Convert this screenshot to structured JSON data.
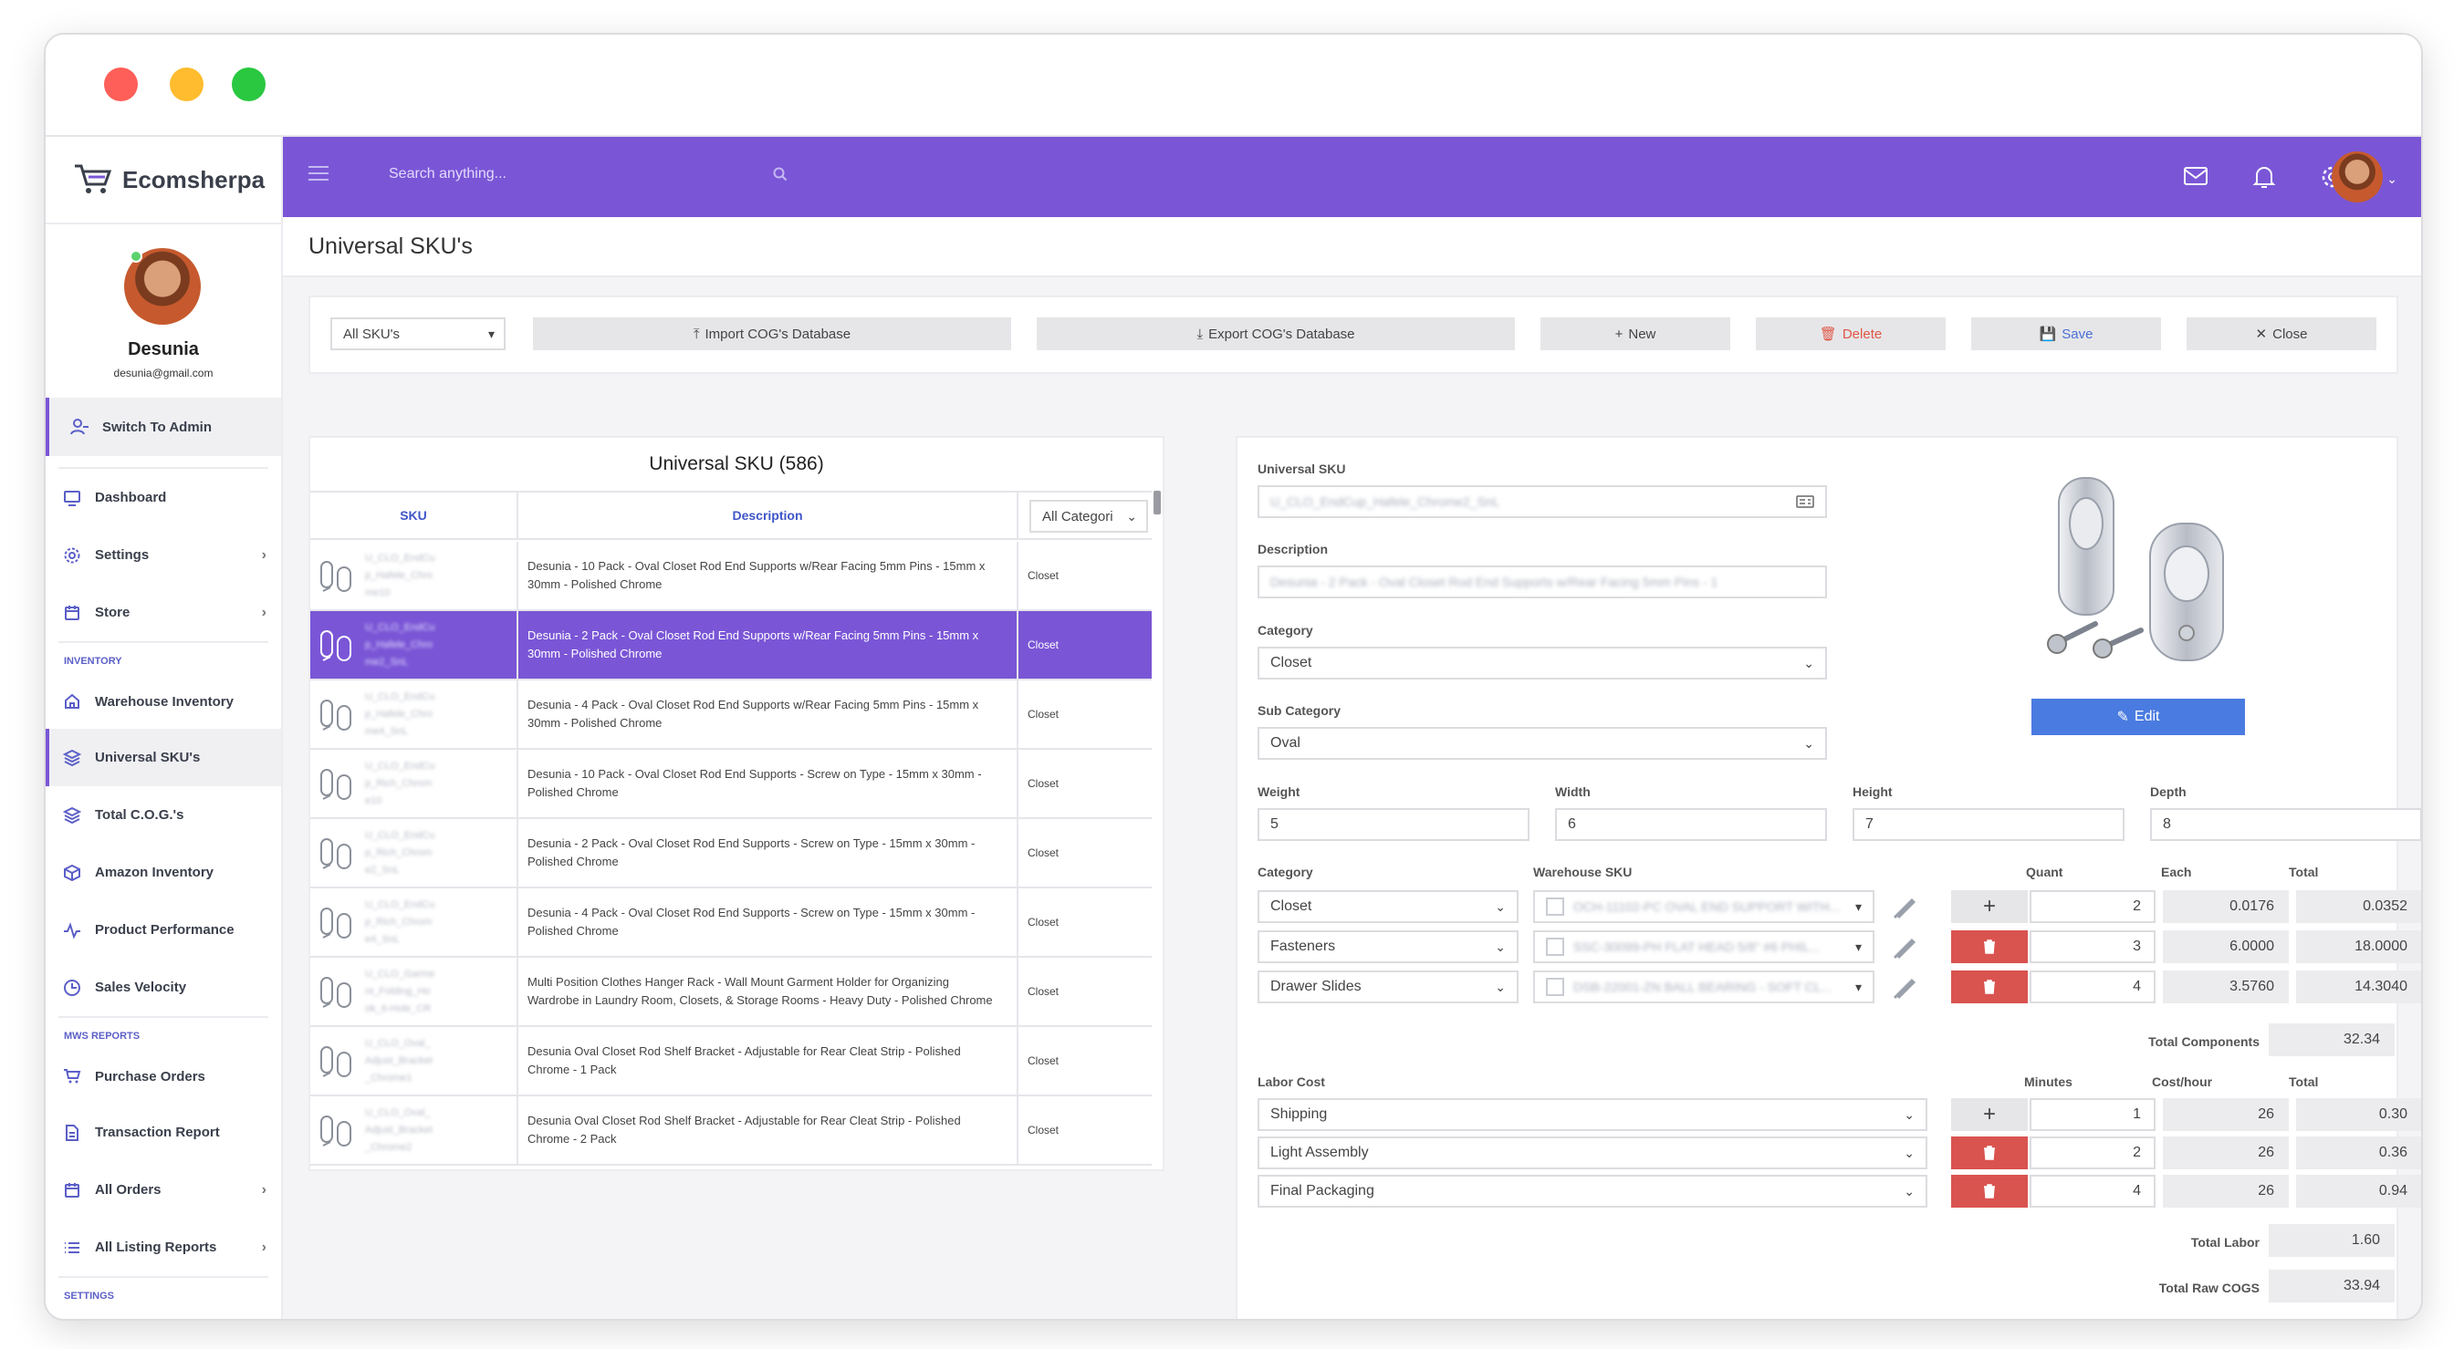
{
  "app": {
    "name": "Ecomsherpa"
  },
  "user": {
    "name": "Desunia",
    "email": "desunia@gmail.com"
  },
  "sidebar": {
    "switch_label": "Switch To Admin",
    "items": [
      {
        "label": "Dashboard",
        "icon": "monitor-icon"
      },
      {
        "label": "Settings",
        "icon": "gear-icon"
      },
      {
        "label": "Store",
        "icon": "calendar-icon"
      }
    ],
    "inventory_title": "INVENTORY",
    "inventory": [
      {
        "label": "Warehouse Inventory",
        "icon": "home-icon"
      },
      {
        "label": "Universal SKU's",
        "icon": "layers-icon"
      },
      {
        "label": "Total C.O.G.'s",
        "icon": "layers-icon"
      },
      {
        "label": "Amazon Inventory",
        "icon": "box-icon"
      },
      {
        "label": "Product Performance",
        "icon": "activity-icon"
      },
      {
        "label": "Sales Velocity",
        "icon": "clock-icon"
      }
    ],
    "reports_title": "MWS REPORTS",
    "reports": [
      {
        "label": "Purchase Orders",
        "icon": "cart-icon"
      },
      {
        "label": "Transaction Report",
        "icon": "file-icon"
      },
      {
        "label": "All Orders",
        "icon": "calendar-icon"
      },
      {
        "label": "All Listing Reports",
        "icon": "list-icon"
      }
    ],
    "settings_title": "SETTINGS"
  },
  "topbar": {
    "search_placeholder": "Search anything..."
  },
  "page": {
    "title": "Universal SKU's"
  },
  "toolbar": {
    "filter": "All SKU's",
    "import": "Import COG's Database",
    "export": "Export COG's Database",
    "new": "New",
    "delete": "Delete",
    "save": "Save",
    "close": "Close"
  },
  "list": {
    "title": "Universal SKU (586)",
    "col_sku": "SKU",
    "col_desc": "Description",
    "col_cat": "All Categori",
    "rows": [
      {
        "sku": [
          "U_CLO_EndCu",
          "p_Hafele_Chro",
          "me10"
        ],
        "desc": "Desunia - 10 Pack - Oval Closet Rod End Supports w/Rear Facing 5mm Pins - 15mm x 30mm - Polished Chrome",
        "cat": "Closet"
      },
      {
        "sku": [
          "U_CLO_EndCu",
          "p_Hafele_Chro",
          "me2_SnL"
        ],
        "desc": "Desunia - 2 Pack - Oval Closet Rod End Supports w/Rear Facing 5mm Pins - 15mm x 30mm - Polished Chrome",
        "cat": "Closet"
      },
      {
        "sku": [
          "U_CLO_EndCu",
          "p_Hafele_Chro",
          "me4_SnL"
        ],
        "desc": "Desunia - 4 Pack - Oval Closet Rod End Supports w/Rear Facing 5mm Pins - 15mm x 30mm - Polished Chrome",
        "cat": "Closet"
      },
      {
        "sku": [
          "U_CLO_EndCu",
          "p_Rich_Chrom",
          "e10"
        ],
        "desc": "Desunia - 10 Pack - Oval Closet Rod End Supports - Screw on Type - 15mm x 30mm - Polished Chrome",
        "cat": "Closet"
      },
      {
        "sku": [
          "U_CLO_EndCu",
          "p_Rich_Chrom",
          "e2_SnL"
        ],
        "desc": "Desunia - 2 Pack - Oval Closet Rod End Supports - Screw on Type - 15mm x 30mm - Polished Chrome",
        "cat": "Closet"
      },
      {
        "sku": [
          "U_CLO_EndCu",
          "p_Rich_Chrom",
          "e4_SnL"
        ],
        "desc": "Desunia - 4 Pack - Oval Closet Rod End Supports - Screw on Type - 15mm x 30mm - Polished Chrome",
        "cat": "Closet"
      },
      {
        "sku": [
          "U_CLO_Garme",
          "nt_Folding_Ho",
          "ok_6-Hole_CR"
        ],
        "desc": "Multi Position Clothes Hanger Rack - Wall Mount Garment Holder for Organizing Wardrobe in Laundry Room, Closets, & Storage Rooms - Heavy Duty - Polished Chrome",
        "cat": "Closet"
      },
      {
        "sku": [
          "U_CLO_Oval_",
          "Adjust_Bracket",
          "_Chrome1"
        ],
        "desc": "Desunia Oval Closet Rod Shelf Bracket - Adjustable for Rear Cleat Strip - Polished Chrome - 1 Pack",
        "cat": "Closet"
      },
      {
        "sku": [
          "U_CLO_Oval_",
          "Adjust_Bracket",
          "_Chrome2"
        ],
        "desc": "Desunia Oval Closet Rod Shelf Bracket - Adjustable for Rear Cleat Strip - Polished Chrome - 2 Pack",
        "cat": "Closet"
      }
    ]
  },
  "detail": {
    "sku_label": "Universal SKU",
    "sku_value": "U_CLO_EndCup_Hafele_Chrome2_SnL",
    "desc_label": "Description",
    "desc_value": "Desunia - 2 Pack - Oval Closet Rod End Supports w/Rear Facing 5mm Pins - 1",
    "category_label": "Category",
    "category_value": "Closet",
    "subcat_label": "Sub Category",
    "subcat_value": "Oval",
    "weight_label": "Weight",
    "weight": "5",
    "width_label": "Width",
    "width": "6",
    "height_label": "Height",
    "height": "7",
    "depth_label": "Depth",
    "depth": "8",
    "edit_label": "Edit",
    "comp_headers": {
      "category": "Category",
      "wsku": "Warehouse SKU",
      "quant": "Quant",
      "each": "Each",
      "total": "Total"
    },
    "components": [
      {
        "category": "Closet",
        "wsku": "OCH-11102-PC OVAL END SUPPORT WITH...",
        "quant": "2",
        "each": "0.0176",
        "total": "0.0352"
      },
      {
        "category": "Fasteners",
        "wsku": "SSC-30099-PH FLAT HEAD 5/8\" #6 PHIL...",
        "quant": "3",
        "each": "6.0000",
        "total": "18.0000"
      },
      {
        "category": "Drawer Slides",
        "wsku": "DSB-22001-ZN BALL BEARING - SOFT CL...",
        "quant": "4",
        "each": "3.5760",
        "total": "14.3040"
      }
    ],
    "total_components_label": "Total Components",
    "total_components": "32.34",
    "labor_headers": {
      "labor": "Labor Cost",
      "minutes": "Minutes",
      "rate": "Cost/hour",
      "total": "Total"
    },
    "labor": [
      {
        "name": "Shipping",
        "minutes": "1",
        "rate": "26",
        "total": "0.30"
      },
      {
        "name": "Light Assembly",
        "minutes": "2",
        "rate": "26",
        "total": "0.36"
      },
      {
        "name": "Final Packaging",
        "minutes": "4",
        "rate": "26",
        "total": "0.94"
      }
    ],
    "total_labor_label": "Total Labor",
    "total_labor": "1.60",
    "total_cogs_label": "Total Raw COGS",
    "total_cogs": "33.94"
  },
  "colors": {
    "accent": "#7a56d6",
    "danger": "#d9534f",
    "primary": "#4a7be0"
  }
}
